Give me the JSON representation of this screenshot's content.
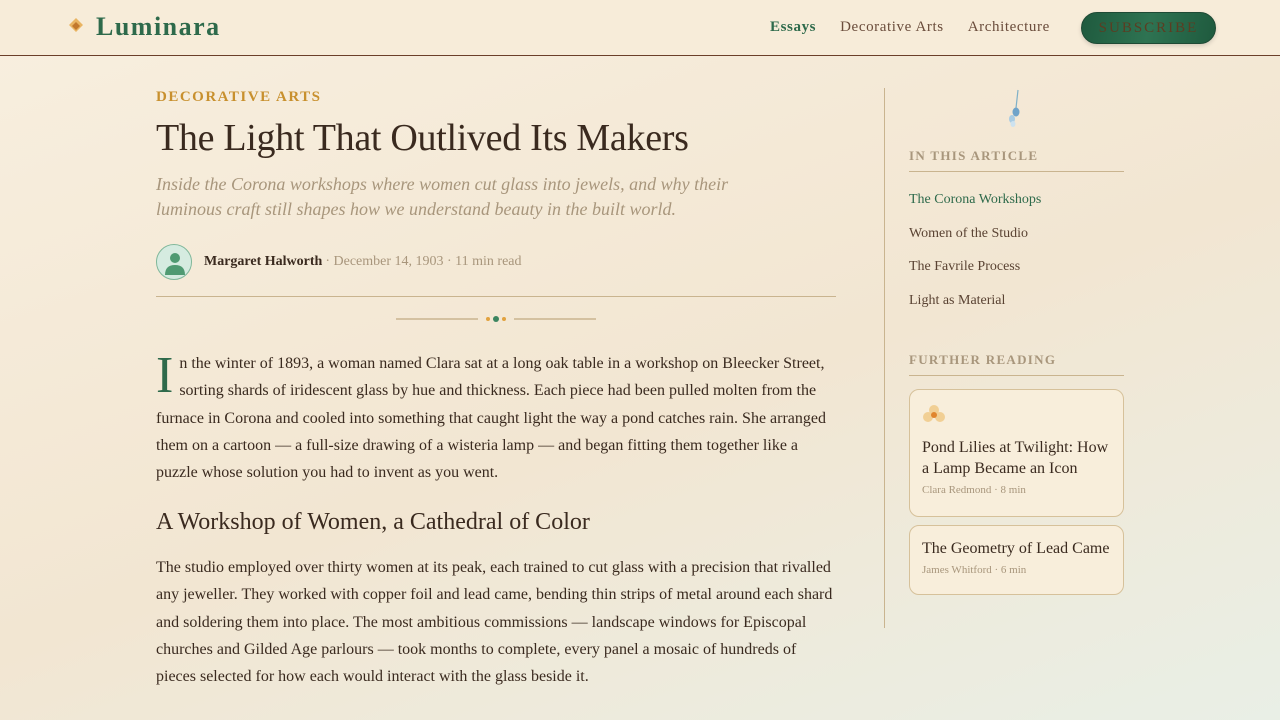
{
  "site": {
    "name": "Luminara"
  },
  "nav": {
    "items": [
      "Essays",
      "Decorative Arts",
      "Architecture"
    ],
    "active": "Essays",
    "subscribe_label": "SUBSCRIBE"
  },
  "article": {
    "category": "DECORATIVE ARTS",
    "title": "The Light That Outlived Its Makers",
    "dek": "Inside the Corona workshops where women cut glass into jewels, and why their luminous craft still shapes how we understand beauty in the built world.",
    "author": "Margaret Halworth",
    "meta": "· December 14, 1903 · 11 min read",
    "dropcap": "I",
    "lead": "n the winter of 1893, a woman named Clara sat at a long oak table in a workshop on Bleecker Street, sorting shards of iridescent glass by hue and thickness. Each piece had been pulled molten from the furnace in Corona and cooled into something that caught light the way a pond catches rain. She arranged them on a cartoon — a full-size drawing of a wisteria lamp — and began fitting them together like a puzzle whose solution you had to invent as you went.",
    "section_heading": "A Workshop of Women, a Cathedral of Color",
    "para2": "The studio employed over thirty women at its peak, each trained to cut glass with a precision that rivalled any jeweller. They worked with copper foil and lead came, bending thin strips of metal around each shard and soldering them into place. The most ambitious commissions — landscape windows for Episcopal churches and Gilded Age parlours — took months to complete, every panel a mosaic of hundreds of pieces selected for how each would interact with the glass beside it."
  },
  "sidebar": {
    "toc_heading": "IN THIS ARTICLE",
    "toc": [
      "The Corona Workshops",
      "Women of the Studio",
      "The Favrile Process",
      "Light as Material"
    ],
    "further_heading": "FURTHER READING",
    "cards": [
      {
        "title": "Pond Lilies at Twilight: How a Lamp Became an Icon",
        "meta": "Clara Redmond · 8 min"
      },
      {
        "title": "The Geometry of Lead Came",
        "meta": "James Whitford · 6 min"
      }
    ]
  },
  "colors": {
    "accent_green": "#2e6a4b",
    "accent_gold": "#c8902e",
    "text": "#3a2a1f",
    "muted": "#a8967c"
  },
  "icons": [
    "logo-diamond-icon",
    "avatar-person-icon",
    "ornament-dots-icon",
    "pendant-drop-icon",
    "lily-flower-icon"
  ]
}
